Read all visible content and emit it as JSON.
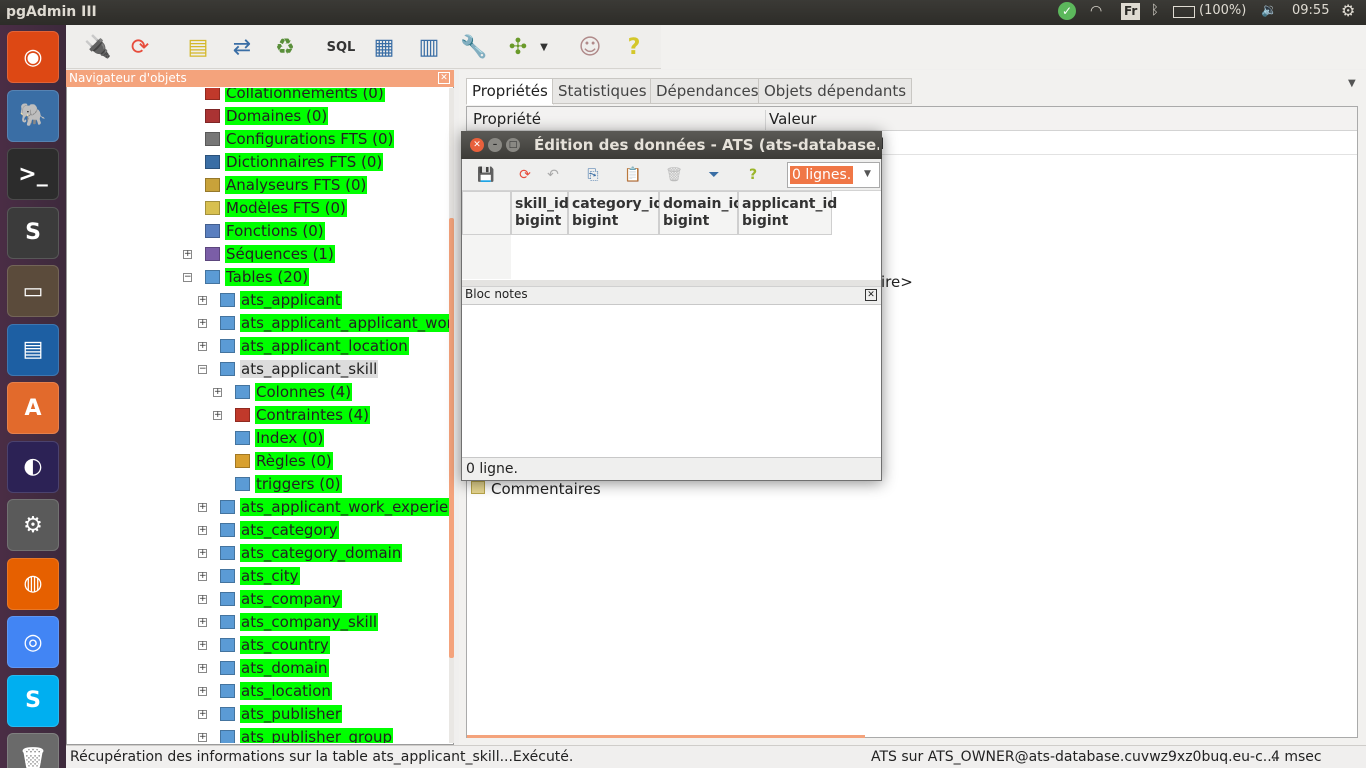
{
  "topbar": {
    "app_title": "pgAdmin III",
    "keyboard_layout": "Fr",
    "battery": "(100%)",
    "clock": "09:55",
    "icons": [
      "update-check-icon",
      "wifi-icon",
      "keyboard-icon",
      "bluetooth-icon",
      "battery-icon",
      "volume-icon",
      "settings-gear-icon"
    ]
  },
  "launcher": {
    "items": [
      {
        "name": "ubuntu-dash",
        "color": "#dd4814",
        "glyph": "◉"
      },
      {
        "name": "pgadmin",
        "color": "#3a6ea5",
        "glyph": "🐘"
      },
      {
        "name": "terminal",
        "color": "#2c2c2c",
        "glyph": ">_"
      },
      {
        "name": "sublime-text",
        "color": "#3b3b3b",
        "glyph": "S"
      },
      {
        "name": "files",
        "color": "#5b4b3b",
        "glyph": "▭"
      },
      {
        "name": "libreoffice-draw",
        "color": "#1d5fa3",
        "glyph": "▤"
      },
      {
        "name": "software-center",
        "color": "#e26a2c",
        "glyph": "A"
      },
      {
        "name": "eclipse",
        "color": "#2c2255",
        "glyph": "◐"
      },
      {
        "name": "system-settings",
        "color": "#5a5a5a",
        "glyph": "⚙"
      },
      {
        "name": "firefox",
        "color": "#e66000",
        "glyph": "◍"
      },
      {
        "name": "chrome",
        "color": "#4285f4",
        "glyph": "◎"
      },
      {
        "name": "skype",
        "color": "#00aff0",
        "glyph": "S"
      },
      {
        "name": "trash",
        "color": "#6a6a6a",
        "glyph": "🗑"
      }
    ]
  },
  "toolbar": {
    "buttons": [
      "connect-icon",
      "refresh-icon",
      "properties-icon",
      "create-icon",
      "delete-icon",
      "sql-query-icon",
      "view-data-icon",
      "filtered-data-icon",
      "maintenance-icon",
      "plugins-icon",
      "hint-icon",
      "help-icon"
    ]
  },
  "navigator": {
    "title": "Navigateur d'objets",
    "rows": [
      {
        "label": "Collationnements (0)",
        "indent": 0,
        "expander": "",
        "icon": "collation-icon",
        "icolor": "#c0392b"
      },
      {
        "label": "Domaines (0)",
        "indent": 0,
        "expander": "",
        "icon": "domain-icon",
        "icolor": "#a33"
      },
      {
        "label": "Configurations FTS (0)",
        "indent": 0,
        "expander": "",
        "icon": "fts-config-icon",
        "icolor": "#777"
      },
      {
        "label": "Dictionnaires FTS (0)",
        "indent": 0,
        "expander": "",
        "icon": "fts-dictionary-icon",
        "icolor": "#3a6ea5"
      },
      {
        "label": "Analyseurs FTS (0)",
        "indent": 0,
        "expander": "",
        "icon": "fts-parser-icon",
        "icolor": "#c8a23a"
      },
      {
        "label": "Modèles FTS (0)",
        "indent": 0,
        "expander": "",
        "icon": "fts-template-icon",
        "icolor": "#d8c050"
      },
      {
        "label": "Fonctions (0)",
        "indent": 0,
        "expander": "",
        "icon": "function-icon",
        "icolor": "#5a7fbf"
      },
      {
        "label": "Séquences (1)",
        "indent": 0,
        "expander": "+",
        "icon": "sequence-icon",
        "icolor": "#7b5ea7"
      },
      {
        "label": "Tables (20)",
        "indent": 0,
        "expander": "-",
        "icon": "tables-icon",
        "icolor": "#5b9bd5"
      },
      {
        "label": "ats_applicant",
        "indent": 1,
        "expander": "+",
        "icon": "table-icon",
        "icolor": "#5b9bd5"
      },
      {
        "label": "ats_applicant_applicant_work_",
        "indent": 1,
        "expander": "+",
        "icon": "table-icon",
        "icolor": "#5b9bd5"
      },
      {
        "label": "ats_applicant_location",
        "indent": 1,
        "expander": "+",
        "icon": "table-icon",
        "icolor": "#5b9bd5"
      },
      {
        "label": "ats_applicant_skill",
        "indent": 1,
        "expander": "-",
        "icon": "table-icon",
        "icolor": "#5b9bd5",
        "selected": true
      },
      {
        "label": "Colonnes (4)",
        "indent": 2,
        "expander": "+",
        "icon": "columns-icon",
        "icolor": "#5b9bd5"
      },
      {
        "label": "Contraintes (4)",
        "indent": 2,
        "expander": "+",
        "icon": "constraints-icon",
        "icolor": "#c0392b"
      },
      {
        "label": "Index (0)",
        "indent": 2,
        "expander": "",
        "icon": "index-icon",
        "icolor": "#5b9bd5"
      },
      {
        "label": "Règles (0)",
        "indent": 2,
        "expander": "",
        "icon": "rules-icon",
        "icolor": "#d8a030"
      },
      {
        "label": "triggers (0)",
        "indent": 2,
        "expander": "",
        "icon": "triggers-icon",
        "icolor": "#5b9bd5"
      },
      {
        "label": "ats_applicant_work_experienc",
        "indent": 1,
        "expander": "+",
        "icon": "table-icon",
        "icolor": "#5b9bd5"
      },
      {
        "label": "ats_category",
        "indent": 1,
        "expander": "+",
        "icon": "table-icon",
        "icolor": "#5b9bd5"
      },
      {
        "label": "ats_category_domain",
        "indent": 1,
        "expander": "+",
        "icon": "table-icon",
        "icolor": "#5b9bd5"
      },
      {
        "label": "ats_city",
        "indent": 1,
        "expander": "+",
        "icon": "table-icon",
        "icolor": "#5b9bd5"
      },
      {
        "label": "ats_company",
        "indent": 1,
        "expander": "+",
        "icon": "table-icon",
        "icolor": "#5b9bd5"
      },
      {
        "label": "ats_company_skill",
        "indent": 1,
        "expander": "+",
        "icon": "table-icon",
        "icolor": "#5b9bd5"
      },
      {
        "label": "ats_country",
        "indent": 1,
        "expander": "+",
        "icon": "table-icon",
        "icolor": "#5b9bd5"
      },
      {
        "label": "ats_domain",
        "indent": 1,
        "expander": "+",
        "icon": "table-icon",
        "icolor": "#5b9bd5"
      },
      {
        "label": "ats_location",
        "indent": 1,
        "expander": "+",
        "icon": "table-icon",
        "icolor": "#5b9bd5"
      },
      {
        "label": "ats_publisher",
        "indent": 1,
        "expander": "+",
        "icon": "table-icon",
        "icolor": "#5b9bd5"
      },
      {
        "label": "ats_publisher_group",
        "indent": 1,
        "expander": "+",
        "icon": "table-icon",
        "icolor": "#5b9bd5"
      }
    ]
  },
  "tabs": [
    {
      "label": "Propriétés",
      "active": true
    },
    {
      "label": "Statistiques",
      "active": false
    },
    {
      "label": "Dépendances",
      "active": false
    },
    {
      "label": "Objets dépendants",
      "active": false
    }
  ],
  "properties": {
    "col_property": "Propriété",
    "col_value": "Valeur",
    "value_fragment_1": "ll",
    "value_fragment_2": "ire>",
    "comments_label": "Commentaires"
  },
  "dialog": {
    "title": "Édition des données - ATS (ats-database.cuvwz",
    "rows_combo": "0 lignes.",
    "columns": [
      {
        "name": "skill_id",
        "type": "bigint"
      },
      {
        "name": "category_id",
        "type": "bigint"
      },
      {
        "name": "domain_id",
        "type": "bigint"
      },
      {
        "name": "applicant_id",
        "type": "bigint"
      }
    ],
    "notes_title": "Bloc notes",
    "status": "0 ligne."
  },
  "statusbar": {
    "message": "Récupération des informations sur la table ats_applicant_skill...Exécuté.",
    "connection": "ATS sur ATS_OWNER@ats-database.cuvwz9xz0buq.eu-c...",
    "timing": "4 msec"
  },
  "colors": {
    "highlight": "#00ff00",
    "accent": "#f4a37c"
  }
}
